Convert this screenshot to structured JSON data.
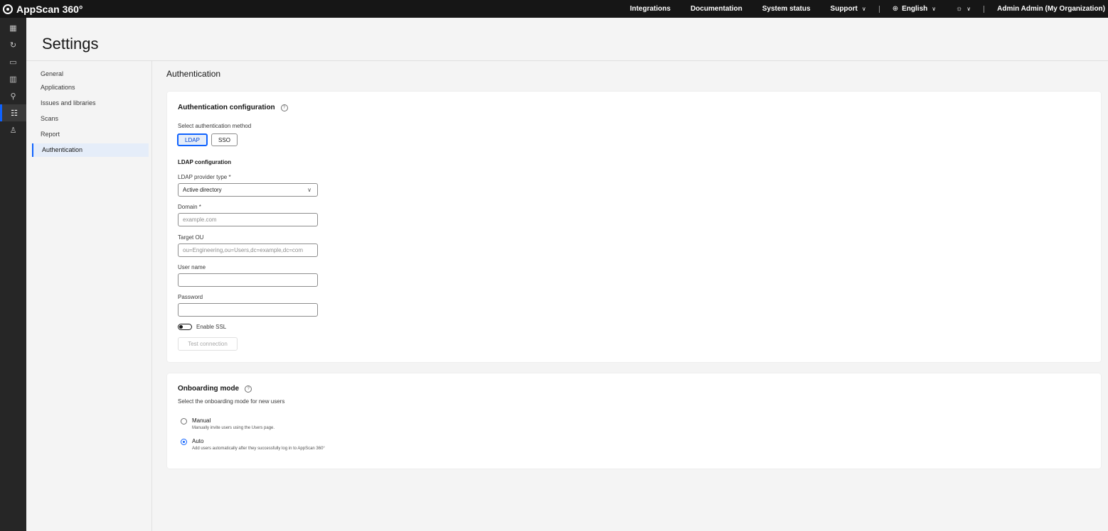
{
  "app": {
    "name": "AppScan 360°"
  },
  "topnav": {
    "integrations": "Integrations",
    "documentation": "Documentation",
    "system_status": "System status",
    "support": "Support",
    "language": "English",
    "user": "Admin Admin (My Organization)"
  },
  "rail": {
    "icons": [
      "dashboard-icon",
      "refresh-icon",
      "folder-icon",
      "reports-chart-icon",
      "wrench-icon",
      "settings-icon",
      "user-icon"
    ]
  },
  "page": {
    "title": "Settings"
  },
  "subnav": {
    "items": [
      {
        "label": "General"
      },
      {
        "label": "Applications"
      },
      {
        "label": "Issues and libraries"
      },
      {
        "label": "Scans"
      },
      {
        "label": "Report"
      },
      {
        "label": "Authentication"
      }
    ],
    "active": "Authentication"
  },
  "main": {
    "section_title": "Authentication",
    "auth_config": {
      "title": "Authentication configuration",
      "method_label": "Select authentication method",
      "methods": [
        "LDAP",
        "SSO"
      ],
      "selected_method": "LDAP",
      "ldap_heading": "LDAP configuration",
      "provider_label": "LDAP provider type *",
      "provider_value": "Active directory",
      "domain_label": "Domain *",
      "domain_placeholder": "example.com",
      "ou_label": "Target OU",
      "ou_placeholder": "ou=Engineering,ou=Users,dc=example,dc=com",
      "username_label": "User name",
      "username_value": "",
      "password_label": "Password",
      "password_value": "",
      "ssl_label": "Enable SSL",
      "ssl_enabled": false,
      "test_button": "Test connection"
    },
    "onboarding": {
      "title": "Onboarding mode",
      "subtitle": "Select the onboarding mode for new users",
      "options": [
        {
          "label": "Manual",
          "desc": "Manually invite users using the Users page."
        },
        {
          "label": "Auto",
          "desc": "Add users automatically after they successfully log in to AppScan 360°"
        }
      ],
      "selected": "Auto"
    }
  },
  "colors": {
    "accent": "#0f62fe",
    "topbar": "#161616",
    "rail": "#262626",
    "background": "#f4f4f4"
  }
}
